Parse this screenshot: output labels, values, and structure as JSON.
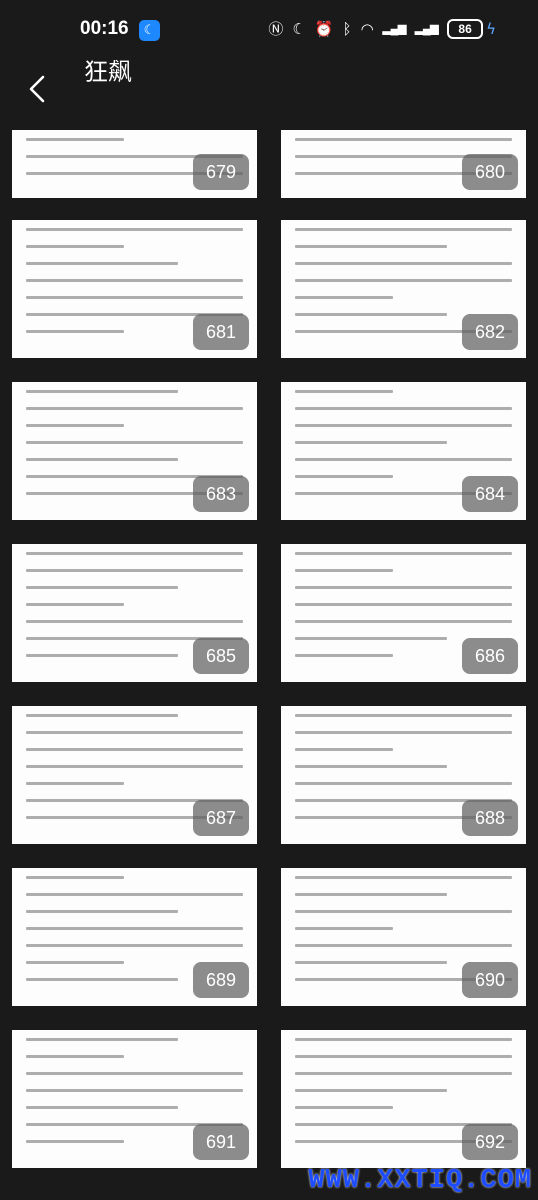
{
  "status": {
    "time": "00:16",
    "battery": "86"
  },
  "header": {
    "title": "狂飙"
  },
  "pages": [
    {
      "number": "679"
    },
    {
      "number": "680"
    },
    {
      "number": "681"
    },
    {
      "number": "682"
    },
    {
      "number": "683"
    },
    {
      "number": "684"
    },
    {
      "number": "685"
    },
    {
      "number": "686"
    },
    {
      "number": "687"
    },
    {
      "number": "688"
    },
    {
      "number": "689"
    },
    {
      "number": "690"
    },
    {
      "number": "691"
    },
    {
      "number": "692"
    }
  ],
  "watermark": "WWW.XXTIQ.COM"
}
